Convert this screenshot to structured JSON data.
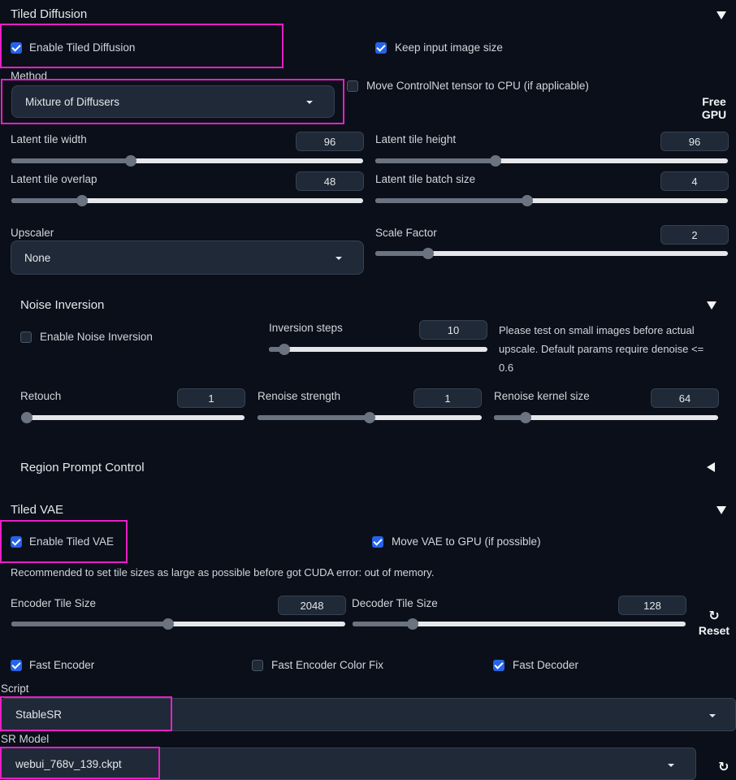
{
  "tiled_diffusion": {
    "title": "Tiled Diffusion",
    "enable_label": "Enable Tiled Diffusion",
    "keep_size_label": "Keep input image size",
    "method_label": "Method",
    "method_value": "Mixture of Diffusers",
    "controlnet_cpu_label": "Move ControlNet tensor to CPU (if applicable)",
    "free_gpu_label_1": "Free",
    "free_gpu_label_2": "GPU",
    "sliders": [
      {
        "label": "Latent tile width",
        "value": "96",
        "fraction": 0.34
      },
      {
        "label": "Latent tile height",
        "value": "96",
        "fraction": 0.34
      },
      {
        "label": "Latent tile overlap",
        "value": "48",
        "fraction": 0.2
      },
      {
        "label": "Latent tile batch size",
        "value": "4",
        "fraction": 0.43
      }
    ],
    "upscaler_label": "Upscaler",
    "upscaler_value": "None",
    "scale_factor": {
      "label": "Scale Factor",
      "value": "2",
      "fraction": 0.15
    }
  },
  "noise_inversion": {
    "title": "Noise Inversion",
    "enable_label": "Enable Noise Inversion",
    "steps": {
      "label": "Inversion steps",
      "value": "10",
      "fraction": 0.07
    },
    "hint": "Please test on small images before actual upscale. Default params require denoise <= 0.6",
    "retouch": {
      "label": "Retouch",
      "value": "1",
      "fraction": 0.0
    },
    "renoise_strength": {
      "label": "Renoise strength",
      "value": "1",
      "fraction": 0.5
    },
    "renoise_kernel": {
      "label": "Renoise kernel size",
      "value": "64",
      "fraction": 0.14
    }
  },
  "region_prompt": {
    "title": "Region Prompt Control"
  },
  "tiled_vae": {
    "title": "Tiled VAE",
    "enable_label": "Enable Tiled VAE",
    "move_gpu_label": "Move VAE to GPU (if possible)",
    "recommend": "Recommended to set tile sizes as large as possible before got CUDA error: out of memory.",
    "encoder": {
      "label": "Encoder Tile Size",
      "value": "2048",
      "fraction": 0.47
    },
    "decoder": {
      "label": "Decoder Tile Size",
      "value": "128",
      "fraction": 0.18
    },
    "reset_label": "Reset",
    "fast_encoder_label": "Fast Encoder",
    "fast_encoder_color_fix_label": "Fast Encoder Color Fix",
    "fast_decoder_label": "Fast Decoder"
  },
  "script": {
    "label": "Script",
    "value": "StableSR"
  },
  "sr_model": {
    "label": "SR Model",
    "value": "webui_768v_139.ckpt"
  },
  "icons": {
    "collapse": "triangle-down-icon",
    "expand": "triangle-left-icon",
    "refresh": "refresh-icon"
  },
  "colors": {
    "background": "#0b0f19",
    "checkbox_accent": "#2563eb",
    "highlight": "#e91ec7"
  }
}
